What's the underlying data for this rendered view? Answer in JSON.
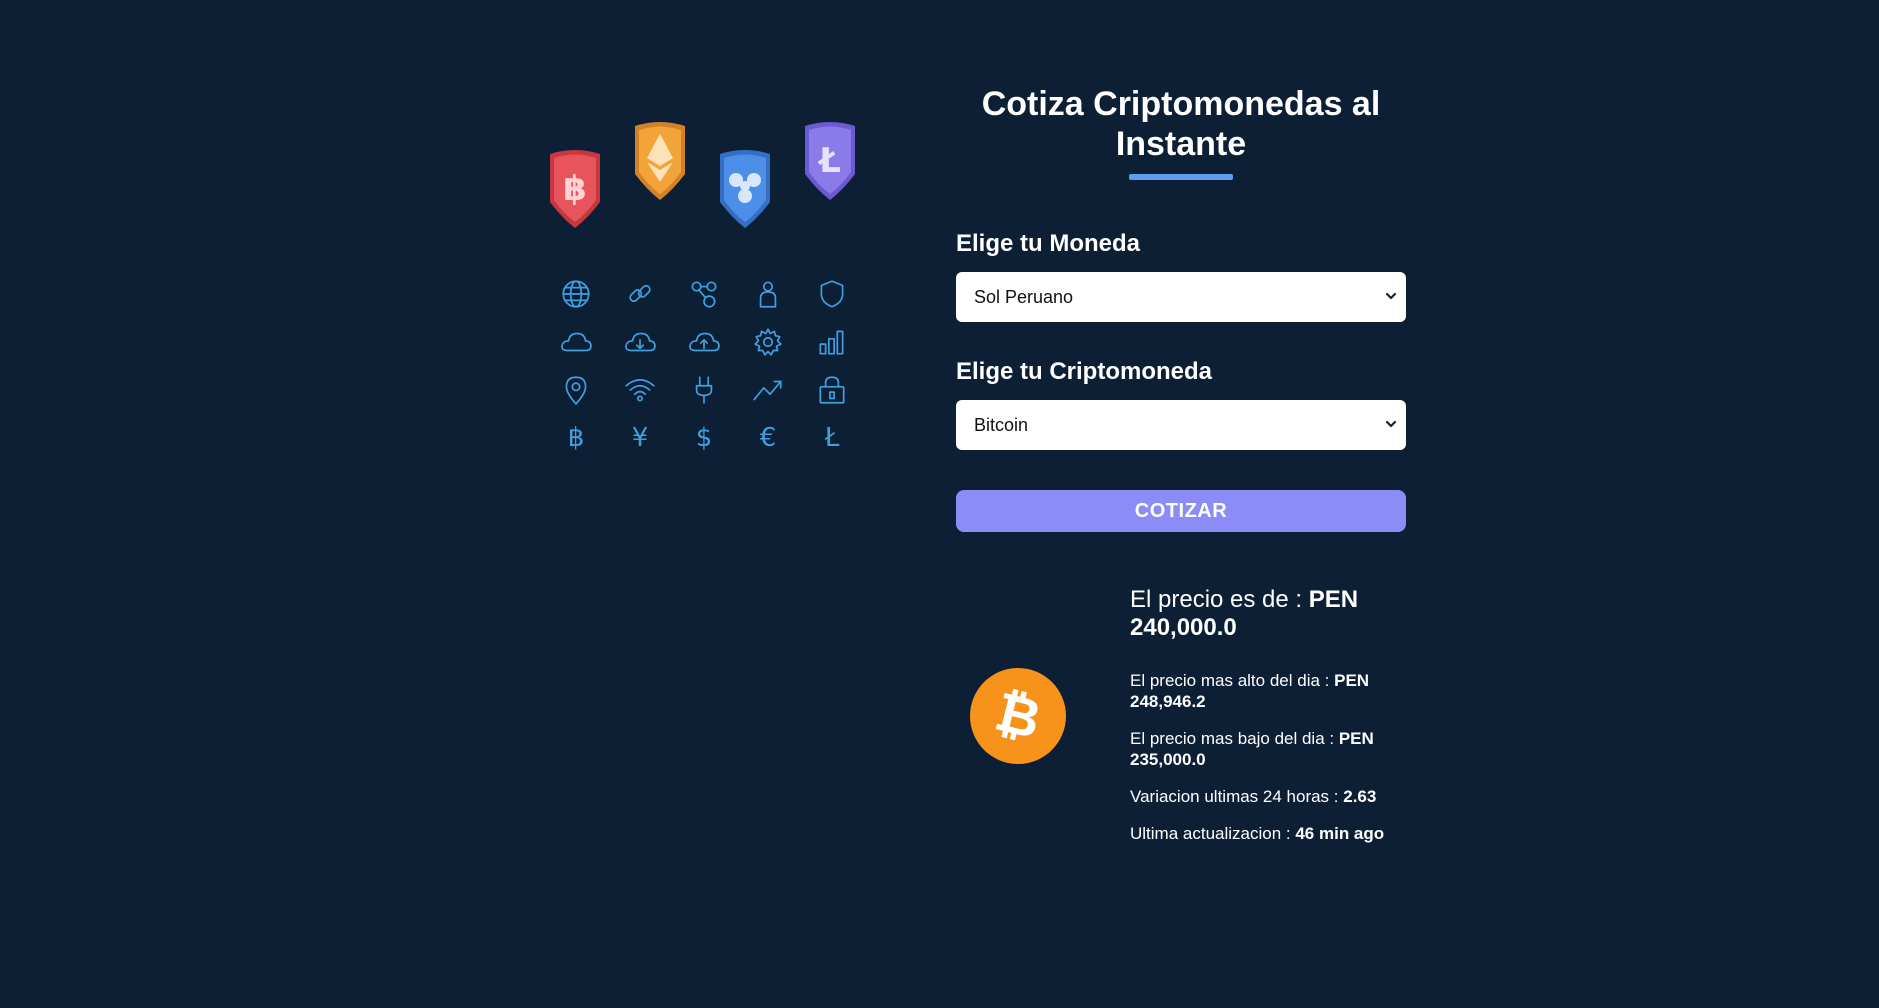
{
  "header": {
    "title": "Cotiza Criptomonedas al Instante"
  },
  "form": {
    "currency_label": "Elige tu Moneda",
    "currency_value": "Sol Peruano",
    "crypto_label": "Elige tu Criptomoneda",
    "crypto_value": "Bitcoin",
    "submit_label": "COTIZAR"
  },
  "result": {
    "price_label": "El precio es de : ",
    "price_value": "PEN 240,000.0",
    "high_label": "El precio mas alto del dia : ",
    "high_value": "PEN 248,946.2",
    "low_label": "El precio mas bajo del dia : ",
    "low_value": "PEN 235,000.0",
    "change_label": "Variacion ultimas 24 horas : ",
    "change_value": "2.63",
    "updated_label": "Ultima actualizacion : ",
    "updated_value": "46 min ago",
    "coin_icon": "bitcoin-coin-icon"
  },
  "illustration": {
    "badges": [
      "bitcoin-badge-icon",
      "ethereum-badge-icon",
      "ripple-badge-icon",
      "litecoin-badge-icon"
    ],
    "badge_colors": [
      "#e8545c",
      "#f2a43a",
      "#4d8fe8",
      "#8a7be8"
    ],
    "icons": [
      "globe-icon",
      "link-icon",
      "nodes-icon",
      "user-icon",
      "shield-icon",
      "cloud-icon",
      "cloud-download-icon",
      "cloud-upload-icon",
      "gear-icon",
      "bar-chart-icon",
      "location-pin-icon",
      "wifi-icon",
      "plug-icon",
      "trend-up-icon",
      "lock-icon",
      "bitcoin-symbol-icon",
      "yen-icon",
      "dollar-icon",
      "euro-icon",
      "litecoin-symbol-icon"
    ],
    "symbols": {
      "bitcoin": "฿",
      "yen": "¥",
      "dollar": "$",
      "euro": "€",
      "litecoin": "Ł"
    },
    "icon_color": "#3fa0e0"
  },
  "colors": {
    "background": "#0d1f35",
    "accent": "#5e9cf0",
    "button": "#8b8cf7",
    "coin": "#f7931a"
  }
}
